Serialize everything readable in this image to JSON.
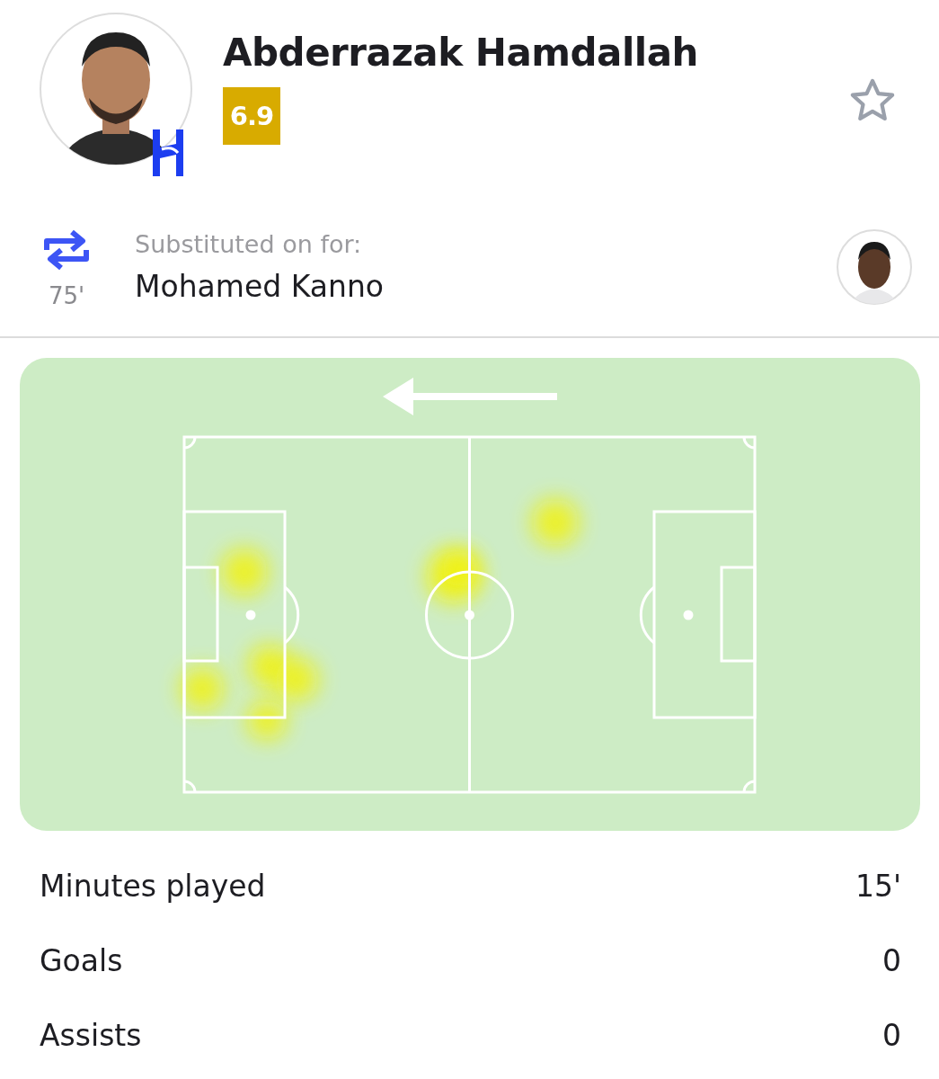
{
  "player": {
    "name": "Abderrazak Hamdallah",
    "rating": "6.9"
  },
  "substitution": {
    "label": "Substituted on for:",
    "player": "Mohamed Kanno",
    "minute": "75'"
  },
  "stats": [
    {
      "label": "Minutes played",
      "value": "15'"
    },
    {
      "label": "Goals",
      "value": "0"
    },
    {
      "label": "Assists",
      "value": "0"
    }
  ]
}
